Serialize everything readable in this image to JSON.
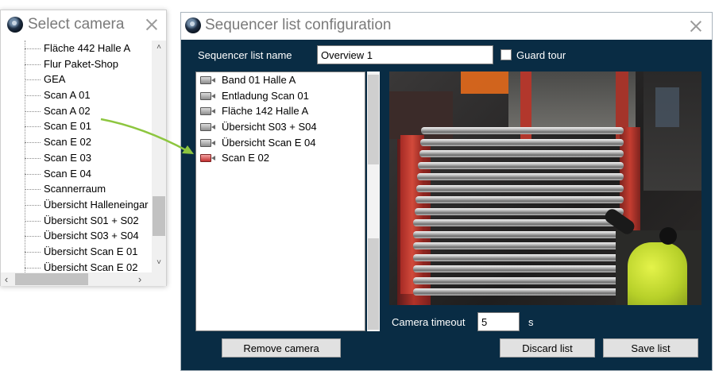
{
  "select_camera": {
    "title": "Select camera",
    "items": [
      "Fläche 442 Halle A",
      "Flur Paket-Shop",
      "GEA",
      "Scan A 01",
      "Scan A 02",
      "Scan E 01",
      "Scan E 02",
      "Scan E 03",
      "Scan E 04",
      "Scannerraum",
      "Übersicht Halleneingar",
      "Übersicht S01 + S02",
      "Übersicht S03 + S04",
      "Übersicht Scan E 01",
      "Übersicht Scan E 02"
    ],
    "scroll_up": "˄",
    "scroll_down": "˅",
    "scroll_left": "‹",
    "scroll_right": "›"
  },
  "sequencer": {
    "title": "Sequencer list configuration",
    "name_label": "Sequencer list name",
    "name_value": "Overview 1",
    "guard_tour_label": "Guard tour",
    "guard_tour_checked": false,
    "cameras": [
      {
        "label": "Band 01 Halle A",
        "active": false
      },
      {
        "label": "Entladung Scan 01",
        "active": false
      },
      {
        "label": "Fläche 142 Halle A",
        "active": false
      },
      {
        "label": "Übersicht S03 + S04",
        "active": false
      },
      {
        "label": "Übersicht Scan E 04",
        "active": false
      },
      {
        "label": "Scan E 02",
        "active": true
      }
    ],
    "camera_timeout_label": "Camera timeout",
    "camera_timeout_value": "5",
    "camera_timeout_unit": "s",
    "remove_button": "Remove camera",
    "discard_button": "Discard list",
    "save_button": "Save list"
  },
  "colors": {
    "sequencer_background": "#092c44",
    "arrow": "#8dc63f",
    "active_camera_icon": "#c22f2f"
  },
  "icons": {
    "app": "camera-lens-icon",
    "close": "close-icon",
    "camera": "camera-icon"
  }
}
